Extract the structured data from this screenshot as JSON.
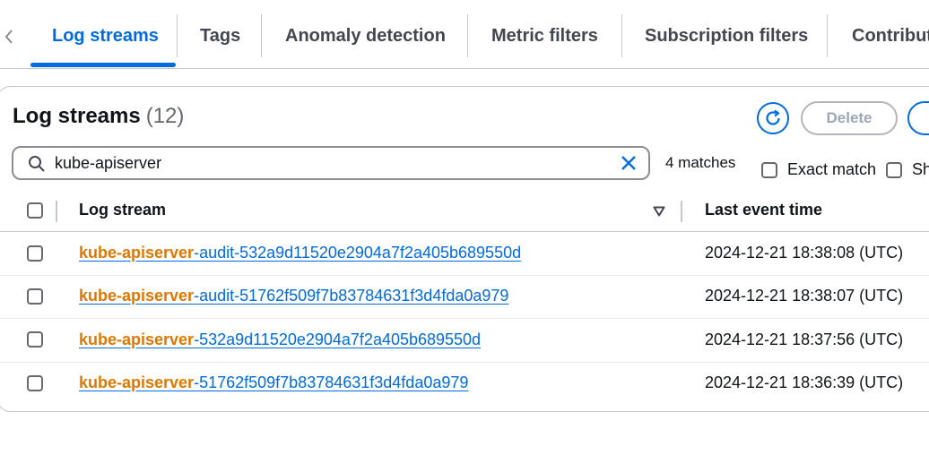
{
  "tabs": [
    {
      "label": "Log streams",
      "active": true
    },
    {
      "label": "Tags"
    },
    {
      "label": "Anomaly detection"
    },
    {
      "label": "Metric filters"
    },
    {
      "label": "Subscription filters"
    },
    {
      "label": "Contribut"
    }
  ],
  "panel": {
    "title": "Log streams",
    "count": "(12)",
    "delete_label": "Delete"
  },
  "search": {
    "value": "kube-apiserver",
    "matches": "4 matches"
  },
  "options": {
    "exact_match_label": "Exact match",
    "show_label": "Sh"
  },
  "table": {
    "columns": [
      "Log stream",
      "Last event time"
    ],
    "rows": [
      {
        "match": "kube-apiserver",
        "rest": "-audit-532a9d11520e2904a7f2a405b689550d",
        "time": "2024-12-21 18:38:08 (UTC)"
      },
      {
        "match": "kube-apiserver",
        "rest": "-audit-51762f509f7b83784631f3d4fda0a979",
        "time": "2024-12-21 18:38:07 (UTC)"
      },
      {
        "match": "kube-apiserver",
        "rest": "-532a9d11520e2904a7f2a405b689550d",
        "time": "2024-12-21 18:37:56 (UTC)"
      },
      {
        "match": "kube-apiserver",
        "rest": "-51762f509f7b83784631f3d4fda0a979",
        "time": "2024-12-21 18:36:39 (UTC)"
      }
    ]
  },
  "colors": {
    "accent": "#006ce0",
    "highlight": "#e07700",
    "border": "#c6c6cd"
  }
}
